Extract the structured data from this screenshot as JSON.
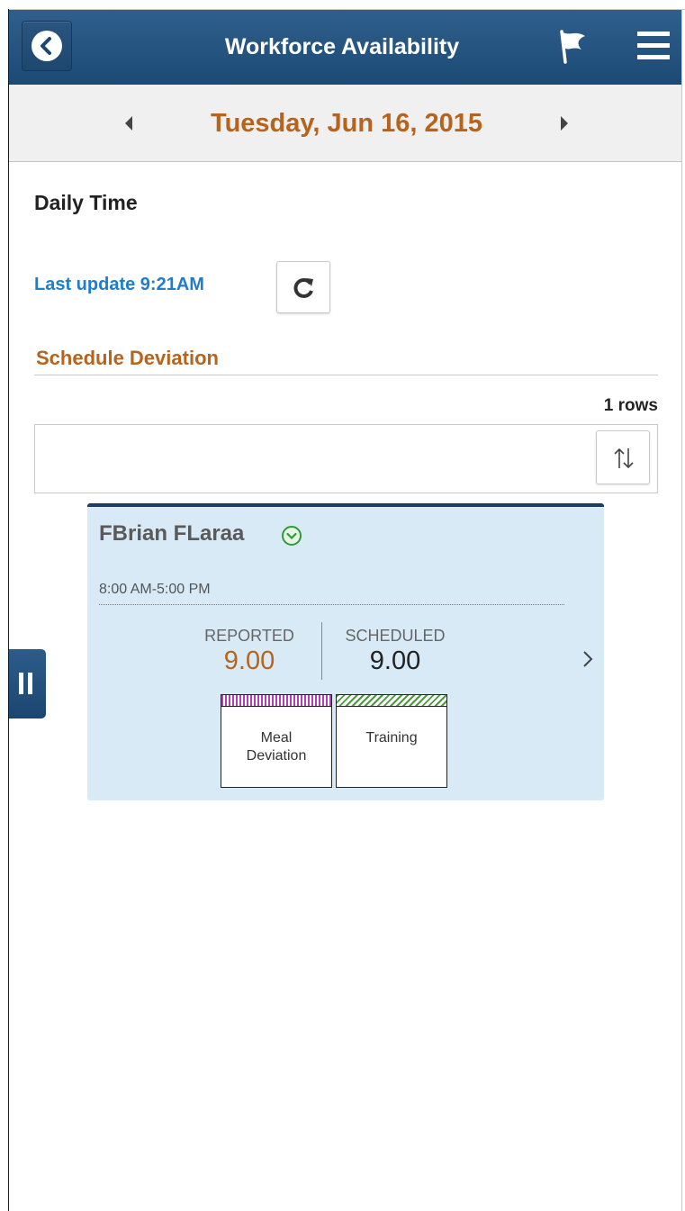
{
  "header": {
    "title": "Workforce Availability",
    "back_icon": "chevron-left-icon",
    "flag_icon": "flag-icon",
    "menu_icon": "hamburger-menu-icon"
  },
  "date_nav": {
    "date": "Tuesday, Jun 16, 2015"
  },
  "page": {
    "section_title": "Daily Time",
    "last_update": "Last update 9:21AM"
  },
  "grid": {
    "title": "Schedule Deviation",
    "rows_count": "1 rows"
  },
  "card": {
    "employee_name": "FBrian FLaraa",
    "shift": "8:00 AM-5:00 PM",
    "reported_label": "REPORTED",
    "reported_value": "9.00",
    "scheduled_label": "SCHEDULED",
    "scheduled_value": "9.00",
    "tags": [
      {
        "label_line1": "Meal",
        "label_line2": "Deviation",
        "color": "#b43fb4"
      },
      {
        "label_line1": "Training",
        "label_line2": "",
        "color": "#4d9a3a"
      }
    ]
  },
  "colors": {
    "header": "#1b4a75",
    "accent_orange": "#b6641d",
    "link_blue": "#1f7ccf",
    "card_bg": "#d8eaf5"
  }
}
